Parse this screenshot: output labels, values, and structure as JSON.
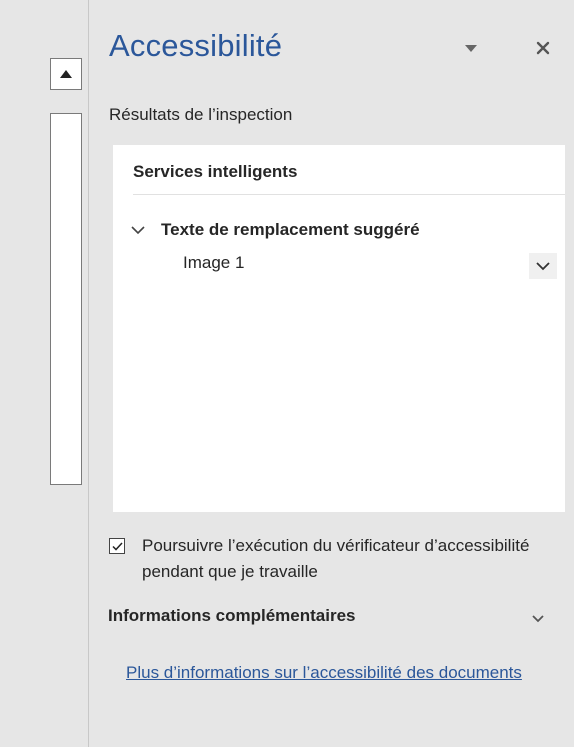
{
  "pane": {
    "title": "Accessibilité",
    "subtitle": "Résultats de l’inspection"
  },
  "results": {
    "section_header": "Services intelligents",
    "group_label": "Texte de remplacement suggéré",
    "items": [
      {
        "label": "Image 1"
      }
    ]
  },
  "options": {
    "keep_checking_label": "Poursuivre l’exécution du vérificateur d’accessibilité pendant que je travaille",
    "keep_checking_checked": true
  },
  "more_info": {
    "header": "Informations complémentaires",
    "link_text": "Plus d’informations sur l’accessibilité des documents"
  },
  "icons": {
    "scroll_up": "triangle-up-icon",
    "pane_menu": "caret-down-icon",
    "close": "close-icon",
    "group_toggle": "chevron-down-icon",
    "item_expand": "chevron-down-icon",
    "more_toggle": "chevron-down-icon",
    "checkbox": "checkmark-icon"
  },
  "colors": {
    "accent": "#2b579a",
    "background": "#e6e6e6",
    "panel": "#ffffff",
    "text": "#262626"
  }
}
